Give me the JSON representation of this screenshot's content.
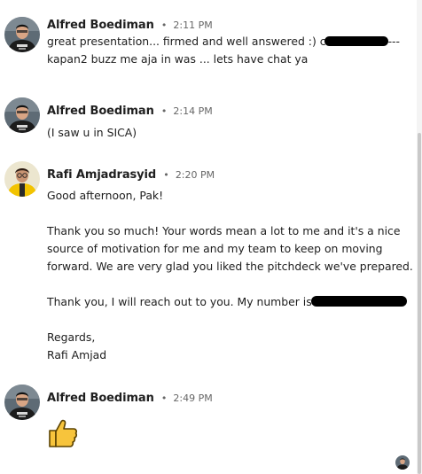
{
  "messages": [
    {
      "sender": "Alfred Boediman",
      "separator": "•",
      "time": "2:11 PM",
      "line1_text": "great presentation... firmed and well answered :) c",
      "line1_tail": "---",
      "line2_text": "kapan2 buzz me aja in was ... lets have chat ya"
    },
    {
      "sender": "Alfred Boediman",
      "separator": "•",
      "time": "2:14 PM",
      "line1_text": "(I saw u in SICA)"
    },
    {
      "sender": "Rafi Amjadrasyid",
      "separator": "•",
      "time": "2:20 PM",
      "greeting": "Good afternoon, Pak!",
      "para1_line1": "Thank you so much! Your words mean a lot to me and it's a nice",
      "para1_line2": "source of motivation for me and my team to keep on moving",
      "para1_line3": "forward. We are very glad you liked the pitchdeck we've prepared.",
      "para2_text": "Thank you, I will reach out to you. My number is",
      "sign1": "Regards,",
      "sign2": "Rafi Amjad"
    },
    {
      "sender": "Alfred Boediman",
      "separator": "•",
      "time": "2:49 PM",
      "reaction_icon": "thumbs-up-icon"
    }
  ],
  "colors": {
    "redaction": "#000000",
    "thumbs_up_fill": "#f7c43c",
    "thumbs_up_outline": "#5a4200",
    "timestamp": "#666666"
  }
}
